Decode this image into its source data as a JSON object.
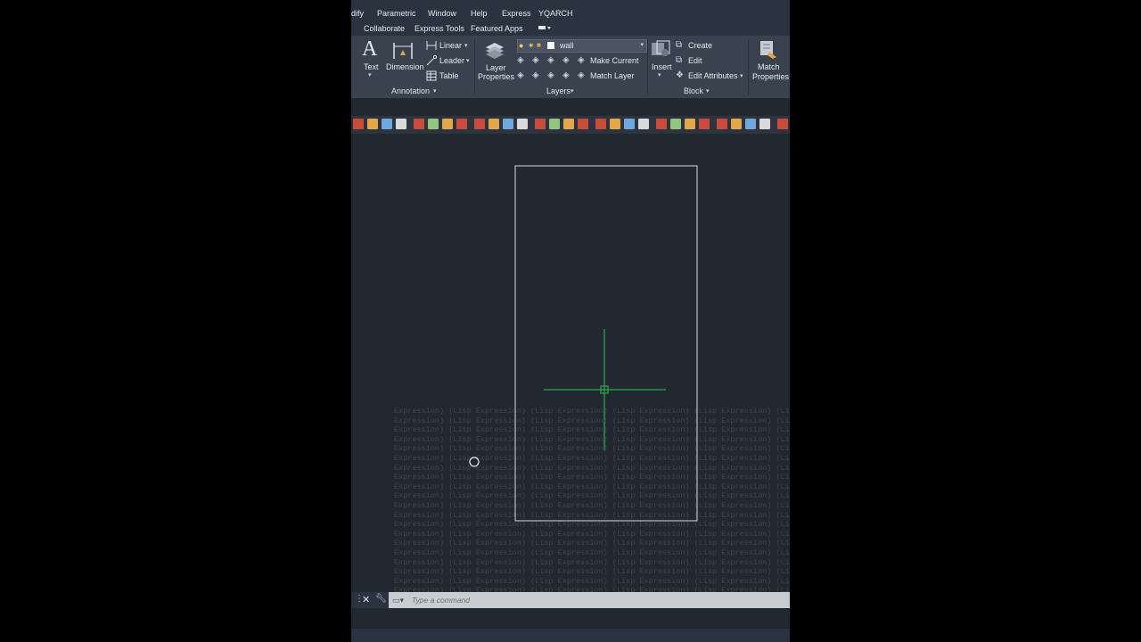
{
  "menu": [
    "dify",
    "Parametric",
    "Window",
    "Help",
    "Express",
    "YQARCH"
  ],
  "ribbon_tabs": [
    "Collaborate",
    "Express Tools",
    "Featured Apps"
  ],
  "annotation": {
    "text_label": "Text",
    "dimension_label": "Dimension",
    "linear_label": "Linear",
    "leader_label": "Leader",
    "table_label": "Table",
    "panel_title": "Annotation"
  },
  "layers": {
    "layer_properties_line1": "Layer",
    "layer_properties_line2": "Properties",
    "current_layer": "wall",
    "make_current_label": "Make Current",
    "match_layer_label": "Match Layer",
    "panel_title": "Layers"
  },
  "block": {
    "insert_label": "Insert",
    "create_label": "Create",
    "edit_label": "Edit",
    "edit_attributes_label": "Edit Attributes",
    "panel_title": "Block"
  },
  "properties": {
    "match_line1": "Match",
    "match_line2": "Properties"
  },
  "command": {
    "placeholder": "Type a command"
  },
  "ghost_text": [
    "Expression) (Lisp Expression) (Lisp Expression) (Lisp Expression) (Lisp Expression) (Lisp",
    "Expression) (Lisp Expression) (Lisp Expression) (Lisp Expression) (Lisp Expression) (Lisp",
    "Expression) (Lisp Expression) (Lisp Expression) (Lisp Expression) (Lisp Expression) (Lisp",
    "Expression) (Lisp Expression) (Lisp Expression) (Lisp Expression) (Lisp Expression) (Lisp",
    "Expression) (Lisp Expression) (Lisp Expression) (Lisp Expression) (Lisp Expression) (Lisp",
    "Expression) (Lisp Expression) (Lisp Expression) (Lisp Expression) (Lisp Expression) (Lisp",
    "Expression) (Lisp Expression) (Lisp Expression) (Lisp Expression) (Lisp Expression) (Lisp",
    "Expression) (Lisp Expression) (Lisp Expression) (Lisp Expression) (Lisp Expression) (Lisp",
    "Expression) (Lisp Expression) (Lisp Expression) (Lisp Expression) (Lisp Expression) (Lisp",
    "Expression) (Lisp Expression) (Lisp Expression) (Lisp Expression) (Lisp Expression) (Lisp",
    "Expression) (Lisp Expression) (Lisp Expression) (Lisp Expression) (Lisp Expression) (Lisp",
    "Expression) (Lisp Expression) (Lisp Expression) (Lisp Expression) (Lisp Expression) (Lisp",
    "Expression) (Lisp Expression) (Lisp Expression) (Lisp Expression) (Lisp Expression) (Lisp",
    "Expression) (Lisp Expression) (Lisp Expression) (Lisp Expression) (Lisp Expression) (Lisp",
    "Expression) (Lisp Expression) (Lisp Expression) (Lisp Expression) (Lisp Expression) (Lisp",
    "Expression) (Lisp Expression) (Lisp Expression) (Lisp Expression) (Lisp Expression) (Lisp",
    "Expression) (Lisp Expression) (Lisp Expression) (Lisp Expression) (Lisp Expression) (Lisp",
    "Expression) (Lisp Expression) (Lisp Expression) (Lisp Expression) (Lisp Expression) (Lisp",
    "Expression) (Lisp Expression) (Lisp Expression) (Lisp Expression) (Lisp Expression) (Lisp",
    "Expression) (Lisp Expression) (Lisp Expression) (Lisp Expression) (Lisp Expression) (Lisp"
  ],
  "colors": {
    "canvas": "#212830",
    "ribbon": "#3a4250",
    "crosshair": "#2fa84f",
    "rectangle": "#d8dbe0"
  }
}
